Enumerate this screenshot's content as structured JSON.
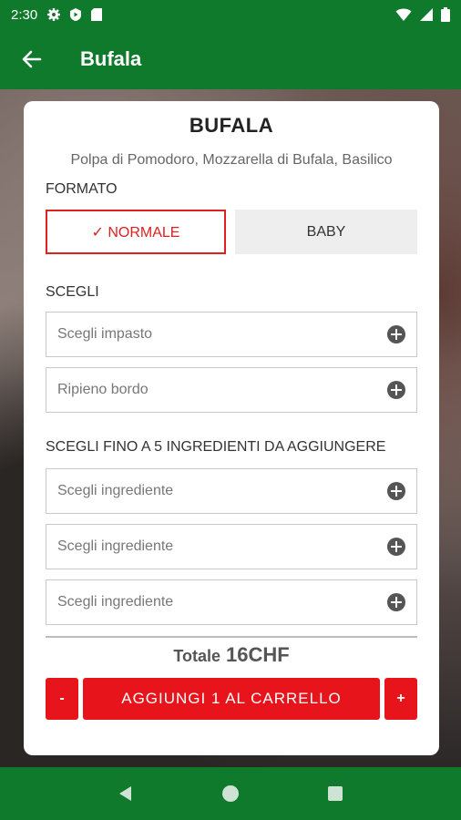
{
  "status_bar": {
    "time": "2:30"
  },
  "app_bar": {
    "title": "Bufala"
  },
  "product": {
    "name": "BUFALA",
    "description": "Polpa di Pomodoro, Mozzarella di Bufala, Basilico"
  },
  "formato": {
    "label": "FORMATO",
    "options": [
      {
        "label": "✓ NORMALE",
        "selected": true
      },
      {
        "label": "BABY",
        "selected": false
      }
    ]
  },
  "scegli": {
    "label": "SCEGLI",
    "fields": [
      {
        "placeholder": "Scegli impasto"
      },
      {
        "placeholder": "Ripieno bordo"
      }
    ]
  },
  "ingredienti": {
    "label": "SCEGLI FINO A 5 INGREDIENTI DA AGGIUNGERE",
    "fields": [
      {
        "placeholder": "Scegli ingrediente"
      },
      {
        "placeholder": "Scegli ingrediente"
      },
      {
        "placeholder": "Scegli ingrediente"
      }
    ]
  },
  "totale": {
    "label": "Totale",
    "value": "16CHF"
  },
  "cart": {
    "minus_label": "-",
    "add_label": "AGGIUNGI 1 AL CARRELLO",
    "plus_label": "+"
  },
  "colors": {
    "primary_green": "#0f7a2c",
    "accent_red": "#e8141b"
  }
}
